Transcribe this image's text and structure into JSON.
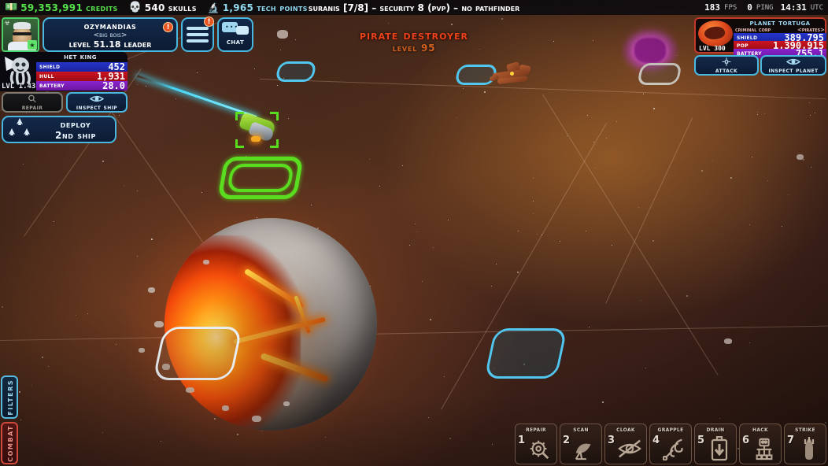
{
  "topbar": {
    "credits": {
      "value": "59,353,991",
      "label": "Credits",
      "icon": "money-stack-icon",
      "color": "#54e04a"
    },
    "skulls": {
      "value": "540",
      "label": "Skulls",
      "icon": "skull-icon",
      "color": "#ffffff"
    },
    "tech": {
      "value": "1,965",
      "label": "Tech Points",
      "icon": "microscope-icon",
      "color": "#8fd8ee"
    },
    "system_info": "Suranis [7/8] – Security 8 (PvP) – No Pathfinder",
    "fps": {
      "value": "183",
      "unit": "FPS"
    },
    "ping": {
      "value": "0",
      "unit": "PING"
    },
    "clock": {
      "value": "14:31",
      "unit": "UTC"
    }
  },
  "player": {
    "avatar_icon": "player-portrait",
    "name": "Ozymandias",
    "corp": "<Big bois>",
    "level_line": "Level 51.18 Leader",
    "name_badge": "!",
    "menu_badge": "!",
    "menu_icon": "hamburger-menu-icon",
    "chat_label": "Chat",
    "chat_icon": "speech-bubbles-icon"
  },
  "ship": {
    "emblem_icon": "squid-skull-emblem",
    "name": "Het King",
    "level": "LVL 1.43",
    "stats": [
      {
        "key": "Shield",
        "value": "452",
        "color": "#2635c9"
      },
      {
        "key": "Hull",
        "value": "1,931",
        "color": "#cc1420"
      },
      {
        "key": "Battery",
        "value": "28.0",
        "color": "#8a24cf"
      }
    ],
    "repair_label": "Repair",
    "repair_icon": "wrench-gear-icon",
    "repair_enabled": false,
    "inspect_label": "Inspect Ship",
    "inspect_icon": "eye-icon",
    "deploy_line1": "Deploy",
    "deploy_line2": "2nd Ship",
    "deploy_icon": "three-ships-icon"
  },
  "planet_panel": {
    "title": "Planet Tortuga",
    "corp": "Criminal Corp",
    "faction": "<Pirates>",
    "level": "LVL 300",
    "planet_icon": "lava-planet-icon",
    "stats": [
      {
        "key": "Shield",
        "value": "389.795",
        "color": "#2635c9"
      },
      {
        "key": "Pop",
        "value": "1,390,915",
        "color": "#cc1420"
      },
      {
        "key": "Battery",
        "value": "755.1",
        "color": "#8a24cf"
      }
    ],
    "attack_label": "Attack",
    "attack_icon": "crosshair-icon",
    "inspect_label": "Inspect Planet",
    "inspect_icon": "eye-icon"
  },
  "enemy": {
    "name": "Pirate Destroyer",
    "level": "Level 95",
    "name_color": "#e8431a"
  },
  "side_tabs": [
    {
      "label": "Filters",
      "color": "#57b9dd"
    },
    {
      "label": "Combat",
      "color": "#d0493c"
    }
  ],
  "abilities": [
    {
      "key": "1",
      "label": "Repair",
      "icon": "gear-wrench-icon"
    },
    {
      "key": "2",
      "label": "Scan",
      "icon": "satellite-dish-icon"
    },
    {
      "key": "3",
      "label": "Cloak",
      "icon": "crossed-eye-icon"
    },
    {
      "key": "4",
      "label": "Grapple",
      "icon": "grapple-hook-icon"
    },
    {
      "key": "5",
      "label": "Drain",
      "icon": "battery-drain-icon"
    },
    {
      "key": "6",
      "label": "Hack",
      "icon": "hack-terminal-icon"
    },
    {
      "key": "7",
      "label": "Strike",
      "icon": "missile-icon"
    }
  ],
  "map": {
    "selection_color": "#5bdd1f",
    "move_tile_color": "#51c6ee",
    "blocked_tile_color": "#c8c4bb"
  }
}
